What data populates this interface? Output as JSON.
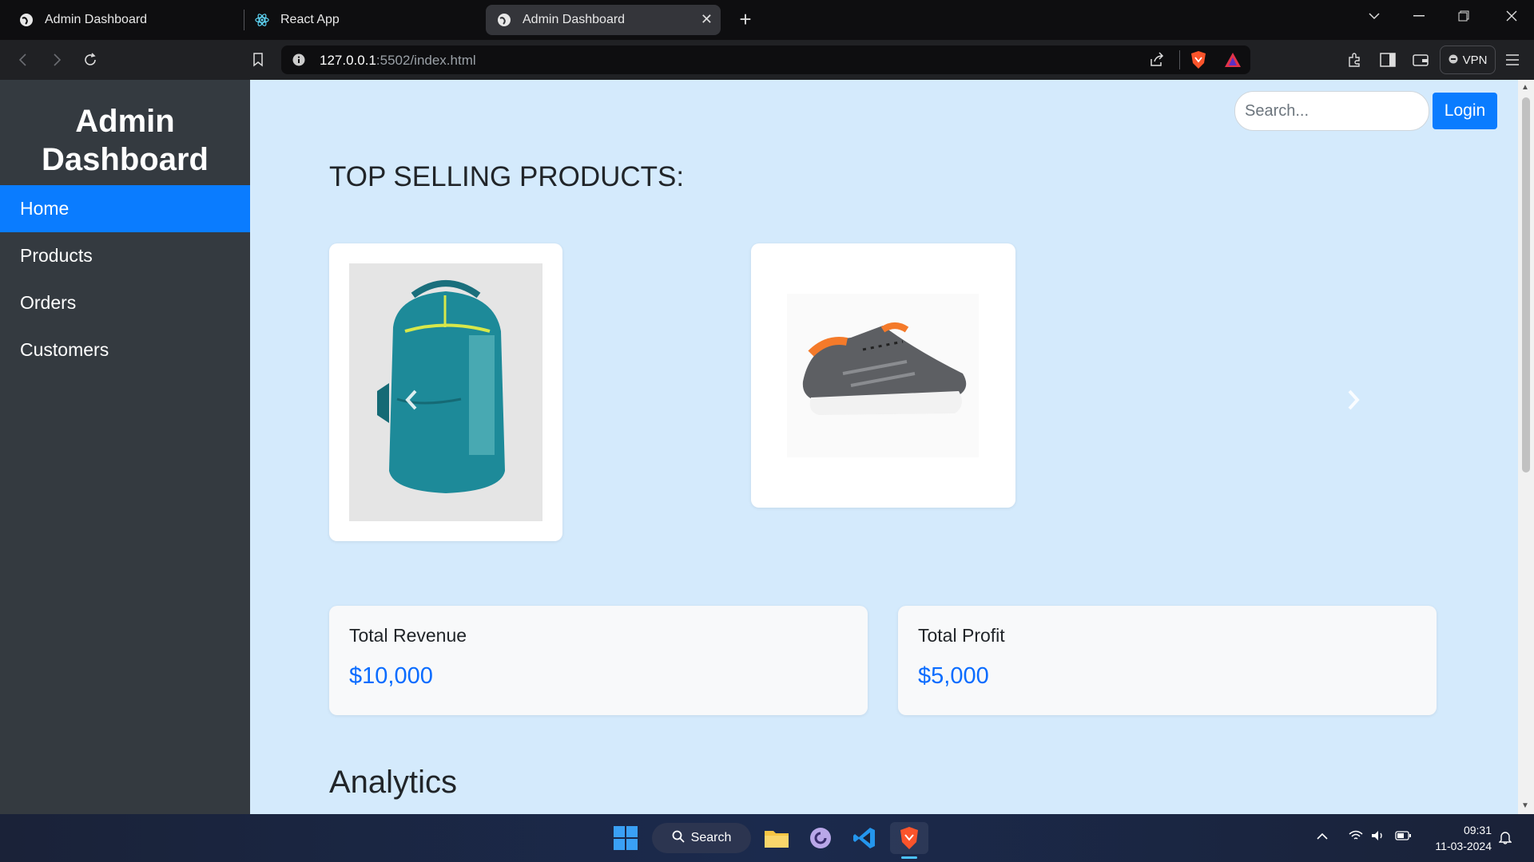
{
  "browser": {
    "tabs": [
      {
        "title": "Admin Dashboard"
      },
      {
        "title": "React App"
      },
      {
        "title": "Admin Dashboard"
      }
    ],
    "url": {
      "host": "127.0.0.1",
      "rest": ":5502/index.html"
    },
    "vpn_label": "VPN"
  },
  "sidebar": {
    "brand": "Admin Dashboard",
    "items": [
      {
        "label": "Home"
      },
      {
        "label": "Products"
      },
      {
        "label": "Orders"
      },
      {
        "label": "Customers"
      }
    ]
  },
  "header": {
    "search_placeholder": "Search...",
    "login_label": "Login"
  },
  "products": {
    "title": "TOP SELLING PRODUCTS:",
    "items": [
      "backpack",
      "sneakers"
    ]
  },
  "stats": [
    {
      "label": "Total Revenue",
      "value": "$10,000"
    },
    {
      "label": "Total Profit",
      "value": "$5,000"
    }
  ],
  "analytics_title": "Analytics",
  "taskbar": {
    "search_label": "Search",
    "time": "09:31",
    "date": "11-03-2024"
  },
  "colors": {
    "accent": "#0a7cff",
    "sidebar": "#343a40",
    "page_bg": "#d4eafc"
  }
}
